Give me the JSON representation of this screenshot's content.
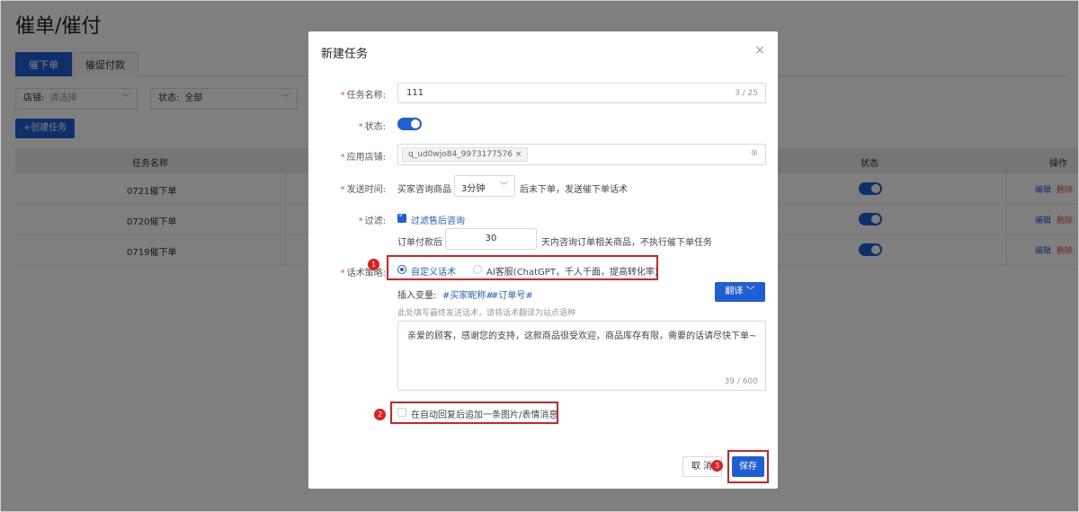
{
  "page": {
    "title": "催单/催付",
    "tabs": [
      "催下单",
      "催促付款"
    ],
    "filters": {
      "store_label": "店铺:",
      "store_placeholder": "请选择",
      "status_label": "状态:",
      "status_value": "全部"
    },
    "create_button": "+创建任务",
    "table": {
      "columns": [
        "任务名称",
        "状态",
        "操作"
      ],
      "rows": [
        {
          "name": "0721催下单",
          "edit": "编辑",
          "delete": "删除"
        },
        {
          "name": "0720催下单",
          "edit": "编辑",
          "delete": "删除"
        },
        {
          "name": "0719催下单",
          "edit": "编辑",
          "delete": "删除"
        }
      ]
    }
  },
  "modal": {
    "title": "新建任务",
    "close_icon": "close-icon",
    "task_name": {
      "label": "任务名称:",
      "value": "111",
      "count": "3 / 25"
    },
    "status": {
      "label": "状态:",
      "enabled": true
    },
    "store": {
      "label": "应用店铺:",
      "tag": "q_ud0wjo84_9973177576",
      "tag_close": "×"
    },
    "send_time": {
      "label": "发送时间:",
      "prefix": "买家咨询商品",
      "select_value": "3分钟",
      "suffix": "后未下单，发送催下单话术"
    },
    "filter": {
      "label": "过滤:",
      "checkbox_label": "过滤售后咨询",
      "checked": true,
      "order_prefix": "订单付款后",
      "order_days": "30",
      "order_suffix": "天内咨询订单相关商品，不执行催下单任务"
    },
    "strategy": {
      "label": "话术策略:",
      "options": [
        "自定义话术",
        "AI客服(ChatGPT，千人千面，提高转化率)"
      ],
      "selected": 0
    },
    "insert_vars": {
      "label": "插入变量:",
      "vars": [
        "#买家昵称#",
        "#订单号#"
      ]
    },
    "translate_button": "翻译",
    "hint": "此处填写最终发送话术，请将话术翻译为站点语种",
    "message": {
      "value": "亲爱的顾客，感谢您的支持，这款商品很受欢迎，商品库存有限，需要的话请尽快下单~",
      "count": "39 / 600"
    },
    "append_image": {
      "label": "在自动回复后追加一条图片/表情消息",
      "checked": false
    },
    "cancel_button": "取 消",
    "save_button": "保存",
    "badges": [
      "1",
      "2",
      "3"
    ]
  }
}
